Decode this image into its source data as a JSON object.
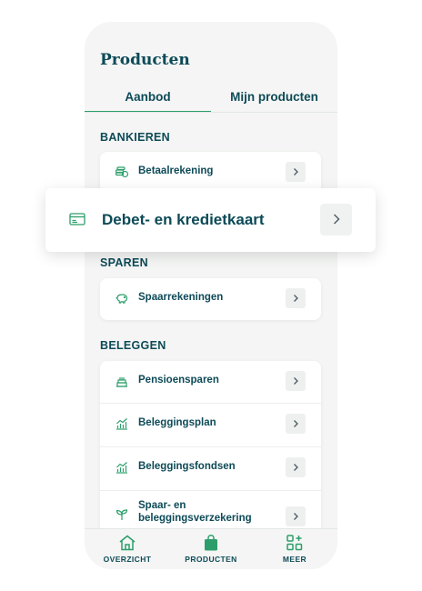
{
  "page": {
    "title": "Producten",
    "tabs": [
      {
        "label": "Aanbod",
        "active": true
      },
      {
        "label": "Mijn producten",
        "active": false
      }
    ]
  },
  "sections": {
    "bankieren": {
      "title": "BANKIEREN",
      "items": [
        {
          "label": "Betaalrekening",
          "icon": "coins-icon"
        }
      ]
    },
    "sparen": {
      "title": "SPAREN",
      "items": [
        {
          "label": "Spaarrekeningen",
          "icon": "piggy-bank-icon"
        }
      ]
    },
    "beleggen": {
      "title": "BELEGGEN",
      "items": [
        {
          "label": "Pensioensparen",
          "icon": "cake-icon"
        },
        {
          "label": "Beleggingsplan",
          "icon": "growth-chart-icon"
        },
        {
          "label": "Beleggingsfondsen",
          "icon": "growth-chart-icon"
        },
        {
          "label": "Spaar- en beleggingsverzekering",
          "icon": "sprout-icon"
        }
      ]
    }
  },
  "highlight": {
    "label": "Debet- en kredietkaart",
    "icon": "credit-card-icon"
  },
  "bottom_nav": [
    {
      "label": "OVERZICHT",
      "icon": "home-icon",
      "active": false
    },
    {
      "label": "PRODUCTEN",
      "icon": "shopping-bag-icon",
      "active": true
    },
    {
      "label": "MEER",
      "icon": "grid-plus-icon",
      "active": false
    }
  ],
  "colors": {
    "primary_text": "#0d4a57",
    "accent": "#2d9e6b",
    "background": "#f4f5f4",
    "card": "#ffffff"
  }
}
